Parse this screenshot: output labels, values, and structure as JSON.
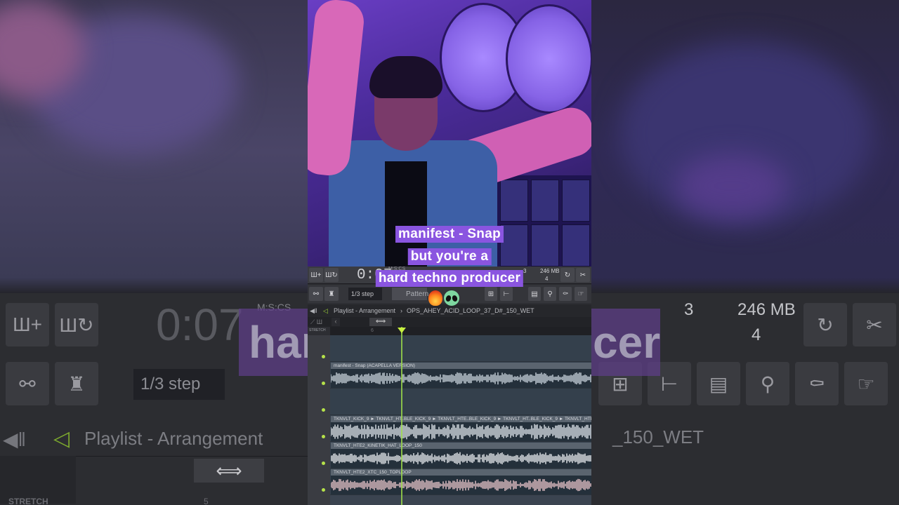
{
  "caption": {
    "lines": [
      "manifest - Snap",
      "but you're a",
      "hard techno producer"
    ],
    "emojis": [
      "fire-emoji",
      "alien-emoji"
    ]
  },
  "background_echo": {
    "time": "0:07",
    "mscs": "M:S:CS",
    "stat_top": "3",
    "stat_mem": "246 MB",
    "stat_bottom": "4",
    "step": "1/3 step",
    "playlist_label": "Playlist - Arrangement",
    "loop_name_tail": "_150_WET",
    "caption_left": "har",
    "caption_right": "cer",
    "stretch": "STRETCH",
    "ruler_mark": "5"
  },
  "toolbar": {
    "time": "0:07",
    "mscs": "M:S:CS",
    "cpu_label": "3",
    "memory": "246 MB",
    "voices": "4",
    "step": "1/3 step",
    "pattern": "Pattern"
  },
  "breadcrumb": {
    "playlist": "Playlist - Arrangement",
    "separator": "›",
    "item": "OPS_AHEY_ACID_LOOP_37_D#_150_WET"
  },
  "ruler": {
    "mark": "6",
    "stretch_label": "STRETCH"
  },
  "tracks": [
    {
      "clip": "",
      "wave_color": "#4a5663"
    },
    {
      "clip": "manifest - Snap (ACAPELLA VERSION)",
      "wave_color": "#c9d3dc"
    },
    {
      "clip": "",
      "wave_color": "#4a5663"
    },
    {
      "clip": "TKNVLT_KICK_9 ► TKNVLT_HT..BLE_KICK_9 ► TKNVLT_HTE..BLE_KICK_9 ► TKNVLT_HT..BLE_KICK_9 ► TKNVLT_HTE..BLE",
      "wave_color": "#dfe4ea"
    },
    {
      "clip": "TKNVLT_HTE2_KINETIK_HAT_LOOP_150",
      "wave_color": "#e7eaee"
    },
    {
      "clip": "TKNVLT_HTE2_XTC_150_TOPLOOP",
      "wave_color": "#e8c4c9"
    }
  ]
}
